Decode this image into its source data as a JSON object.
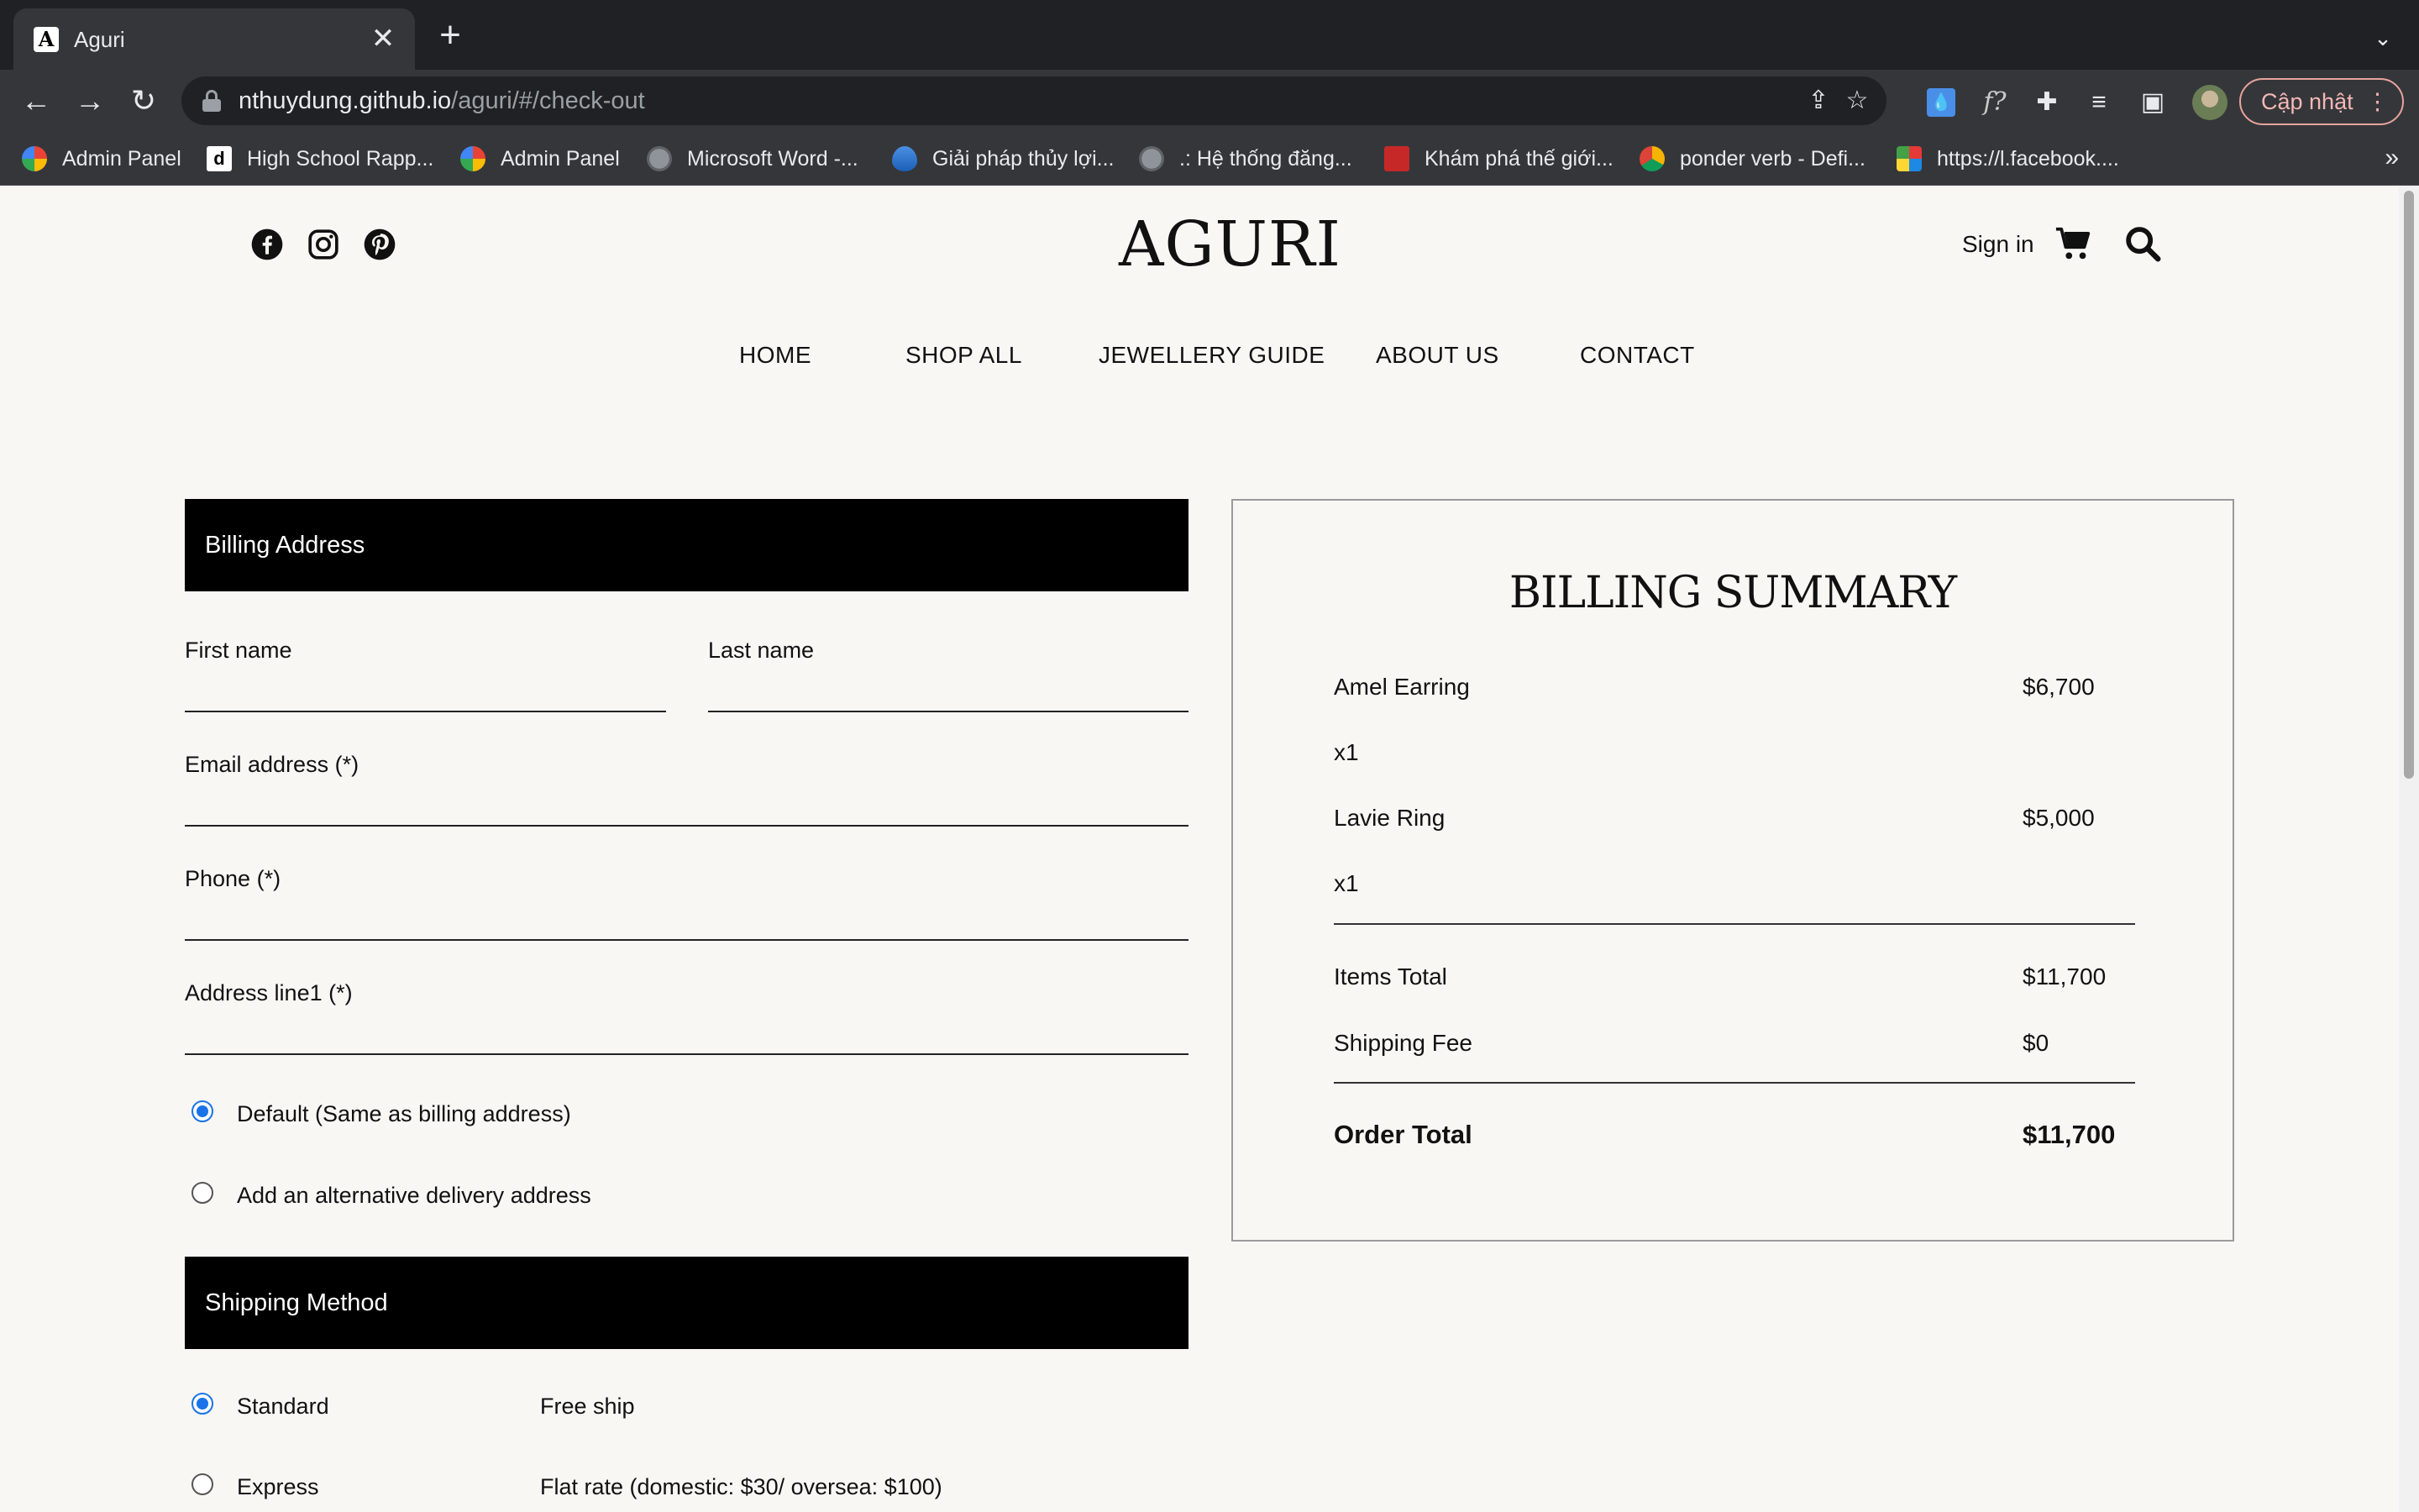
{
  "browser": {
    "tab_title": "Aguri",
    "tab_close": "✕",
    "new_tab": "+",
    "url_host": "nthuydung.github.io",
    "url_path": "/aguri/#/check-out",
    "update_label": "Cập nhật",
    "bookmarks": [
      {
        "label": "Admin Panel",
        "icon": "google-icon"
      },
      {
        "label": "High School Rapp...",
        "icon": "d-icon"
      },
      {
        "label": "Admin Panel",
        "icon": "google-icon"
      },
      {
        "label": "Microsoft Word -...",
        "icon": "globe-icon"
      },
      {
        "label": "Giải pháp thủy lợi...",
        "icon": "water-drop-icon"
      },
      {
        "label": ".: Hệ thống đăng...",
        "icon": "globe-icon"
      },
      {
        "label": "Khám phá thế giới...",
        "icon": "red-square-icon"
      },
      {
        "label": "ponder verb - Defi...",
        "icon": "dictionary-icon"
      },
      {
        "label": "https://l.facebook....",
        "icon": "x-colorful-icon"
      }
    ],
    "bookmarks_more": "»"
  },
  "header": {
    "logo": "AGURI",
    "sign_in": "Sign in"
  },
  "nav": {
    "items": [
      "HOME",
      "SHOP ALL",
      "JEWELLERY GUIDE",
      "ABOUT US",
      "CONTACT"
    ]
  },
  "billing": {
    "title": "Billing Address",
    "first_name": "First name",
    "last_name": "Last name",
    "email": "Email address (*)",
    "phone": "Phone (*)",
    "address": "Address line1 (*)",
    "delivery_options": [
      {
        "label": "Default (Same as billing address)",
        "checked": true
      },
      {
        "label": "Add an alternative delivery address",
        "checked": false
      }
    ]
  },
  "shipping": {
    "title": "Shipping Method",
    "options": [
      {
        "label": "Standard",
        "desc": "Free ship",
        "checked": true
      },
      {
        "label": "Express",
        "desc": "Flat rate (domestic: $30/ oversea: $100)",
        "checked": false
      }
    ]
  },
  "summary": {
    "title": "BILLING SUMMARY",
    "items": [
      {
        "name": "Amel Earring",
        "price": "$6,700",
        "qty": "x1"
      },
      {
        "name": "Lavie Ring",
        "price": "$5,000",
        "qty": "x1"
      }
    ],
    "items_total_label": "Items Total",
    "items_total": "$11,700",
    "shipping_label": "Shipping Fee",
    "shipping": "$0",
    "order_total_label": "Order Total",
    "order_total": "$11,700"
  },
  "colors": {
    "accent": "#1a73e8",
    "section_bar": "#000000",
    "page_bg": "#f8f7f4"
  }
}
